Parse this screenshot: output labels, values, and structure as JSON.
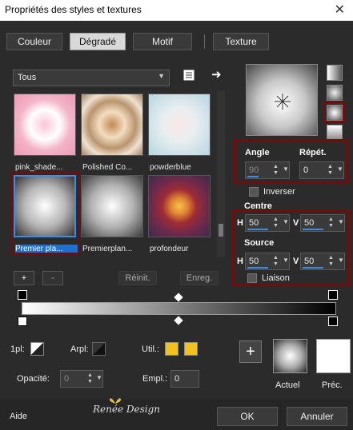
{
  "window": {
    "title": "Propriétés des styles et textures",
    "close": "✕"
  },
  "tabs": [
    {
      "label": "Couleur",
      "active": false
    },
    {
      "label": "Dégradé",
      "active": true
    },
    {
      "label": "Motif",
      "active": false
    },
    {
      "label": "Texture",
      "active": false
    }
  ],
  "category_select": {
    "value": "Tous"
  },
  "gallery": [
    {
      "label": "pink_shade...",
      "selected": false
    },
    {
      "label": "Polished Co...",
      "selected": false
    },
    {
      "label": "powderblue",
      "selected": false
    },
    {
      "label": "Premier pla...",
      "selected": true
    },
    {
      "label": "Premierplan...",
      "selected": false
    },
    {
      "label": "profondeur",
      "selected": false
    }
  ],
  "controls": {
    "angle_label": "Angle",
    "angle_value": "90",
    "repeat_label": "Répét.",
    "repeat_value": "0",
    "invert_label": "Inverser",
    "centre_label": "Centre",
    "centre_h": "50",
    "centre_v": "50",
    "source_label": "Source",
    "source_h": "50",
    "source_v": "50",
    "h_label": "H",
    "v_label": "V",
    "link_label": "Liaison"
  },
  "buttons": {
    "add": "+",
    "remove": "-",
    "reset": "Réinit.",
    "save": "Enreg."
  },
  "stops": {
    "opl_label": "1pl:",
    "arpl_label": "Arpl:",
    "util_label": "Util.:",
    "opacity_label": "Opacité:",
    "opacity_value": "0",
    "empl_label": "Empl.:",
    "empl_value": "0"
  },
  "preview": {
    "actual_label": "Actuel",
    "prev_label": "Préc."
  },
  "footer": {
    "help": "Aide",
    "watermark": "Renée Design",
    "ok": "OK",
    "cancel": "Annuler"
  },
  "colors": {
    "accent": "#3b8ee8",
    "highlight": "#6e0f0f",
    "swatch": "#f2c21b"
  }
}
